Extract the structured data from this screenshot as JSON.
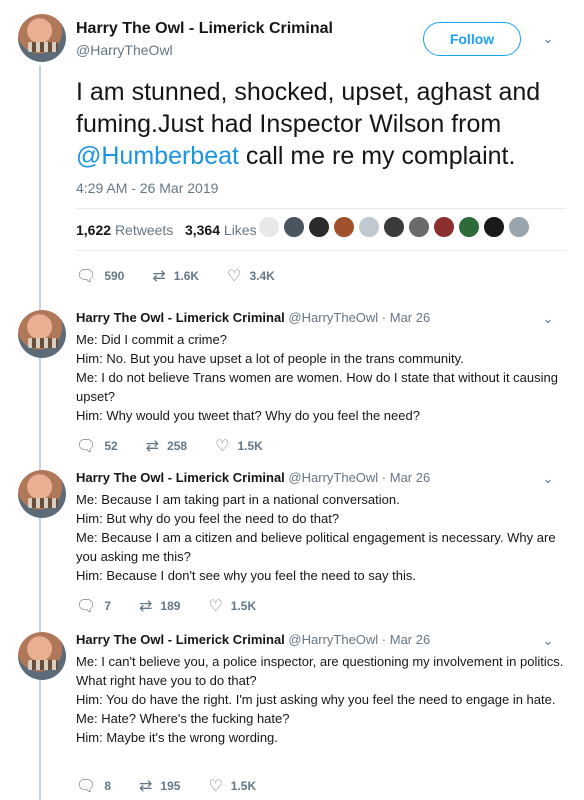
{
  "main": {
    "name": "Harry The Owl - Limerick Criminal",
    "handle": "@HarryTheOwl",
    "follow_label": "Follow",
    "text_before": "I am stunned, shocked, upset, aghast and fuming.Just had Inspector Wilson from ",
    "mention": "@Humberbeat",
    "text_after": " call me re my complaint.",
    "timestamp": "4:29 AM - 26 Mar 2019",
    "retweets_count": "1,622",
    "retweets_label": "Retweets",
    "likes_count": "3,364",
    "likes_label": "Likes",
    "replies": "590",
    "retweets_short": "1.6K",
    "likes_short": "3.4K"
  },
  "likers_colors": [
    "#e8e8e8",
    "#4a5560",
    "#2b2b2b",
    "#a0522d",
    "#c0c8d0",
    "#3a3a3a",
    "#6a6a6a",
    "#8b2e2e",
    "#2f6b3a",
    "#1a1a1a",
    "#9aa4ad"
  ],
  "replies": [
    {
      "name": "Harry The Owl - Limerick Criminal",
      "handle": "@HarryTheOwl · Mar 26",
      "lines": [
        "Me: Did I commit a crime?",
        "Him: No. But you have upset a lot of people in the trans community.",
        "Me: I do not believe Trans women are women. How do I state that without it causing upset?",
        "Him: Why would you tweet that? Why do you feel the need?"
      ],
      "reply_count": "52",
      "retweet_count": "258",
      "like_count": "1.5K"
    },
    {
      "name": "Harry The Owl - Limerick Criminal",
      "handle": "@HarryTheOwl · Mar 26",
      "lines": [
        "Me: Because I am taking part in a national conversation.",
        "Him: But why do you feel the need to do that?",
        "Me: Because I am a citizen and believe political engagement is necessary. Why are you asking me this?",
        "Him: Because I don't see why you feel the need to say this."
      ],
      "reply_count": "7",
      "retweet_count": "189",
      "like_count": "1.5K"
    },
    {
      "name": "Harry The Owl - Limerick Criminal",
      "handle": "@HarryTheOwl · Mar 26",
      "lines": [
        "Me: I can't believe you, a police inspector, are questioning my involvement in politics. What right have you to do that?",
        "Him: You do have the right. I'm just asking why you feel the need to engage in hate.",
        "Me: Hate? Where's the fucking hate?",
        "Him: Maybe it's the wrong wording."
      ],
      "reply_count": "8",
      "retweet_count": "195",
      "like_count": "1.5K"
    }
  ],
  "icons": {
    "reply": "reply-icon",
    "retweet": "retweet-icon",
    "like": "heart-icon",
    "more": "chevron-down-icon"
  },
  "colors": {
    "accent": "#1da1f2",
    "link": "#1b95e0",
    "muted": "#657786"
  }
}
